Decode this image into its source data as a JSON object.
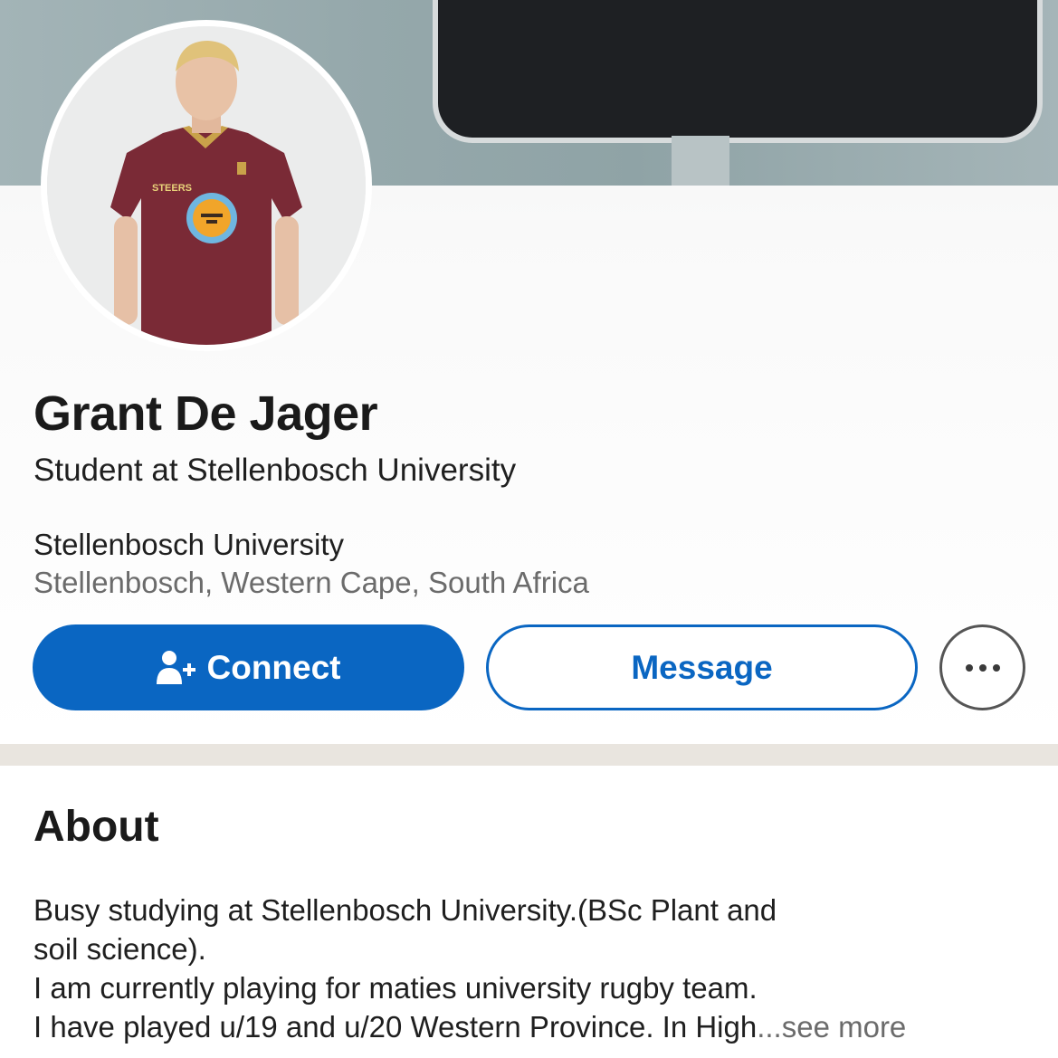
{
  "profile": {
    "name": "Grant De Jager",
    "headline": "Student at Stellenbosch University",
    "education": "Stellenbosch University",
    "location": "Stellenbosch, Western Cape, South Africa",
    "avatar_icon": "profile-photo",
    "cover_icon": "cover-photo-monitor"
  },
  "actions": {
    "connect_label": "Connect",
    "connect_icon": "add-person-icon",
    "message_label": "Message",
    "more_icon": "more-options-icon"
  },
  "about": {
    "title": "About",
    "lines": [
      "Busy studying at Stellenbosch University.(BSc Plant and",
      "soil science).",
      "I am currently playing for maties university rugby team.",
      "I have played u/19 and u/20 Western Province. In High"
    ],
    "see_more_label": "...see more"
  },
  "colors": {
    "accent": "#0a66c2",
    "divider": "#e9e5df",
    "jersey": "#7a2a36"
  }
}
